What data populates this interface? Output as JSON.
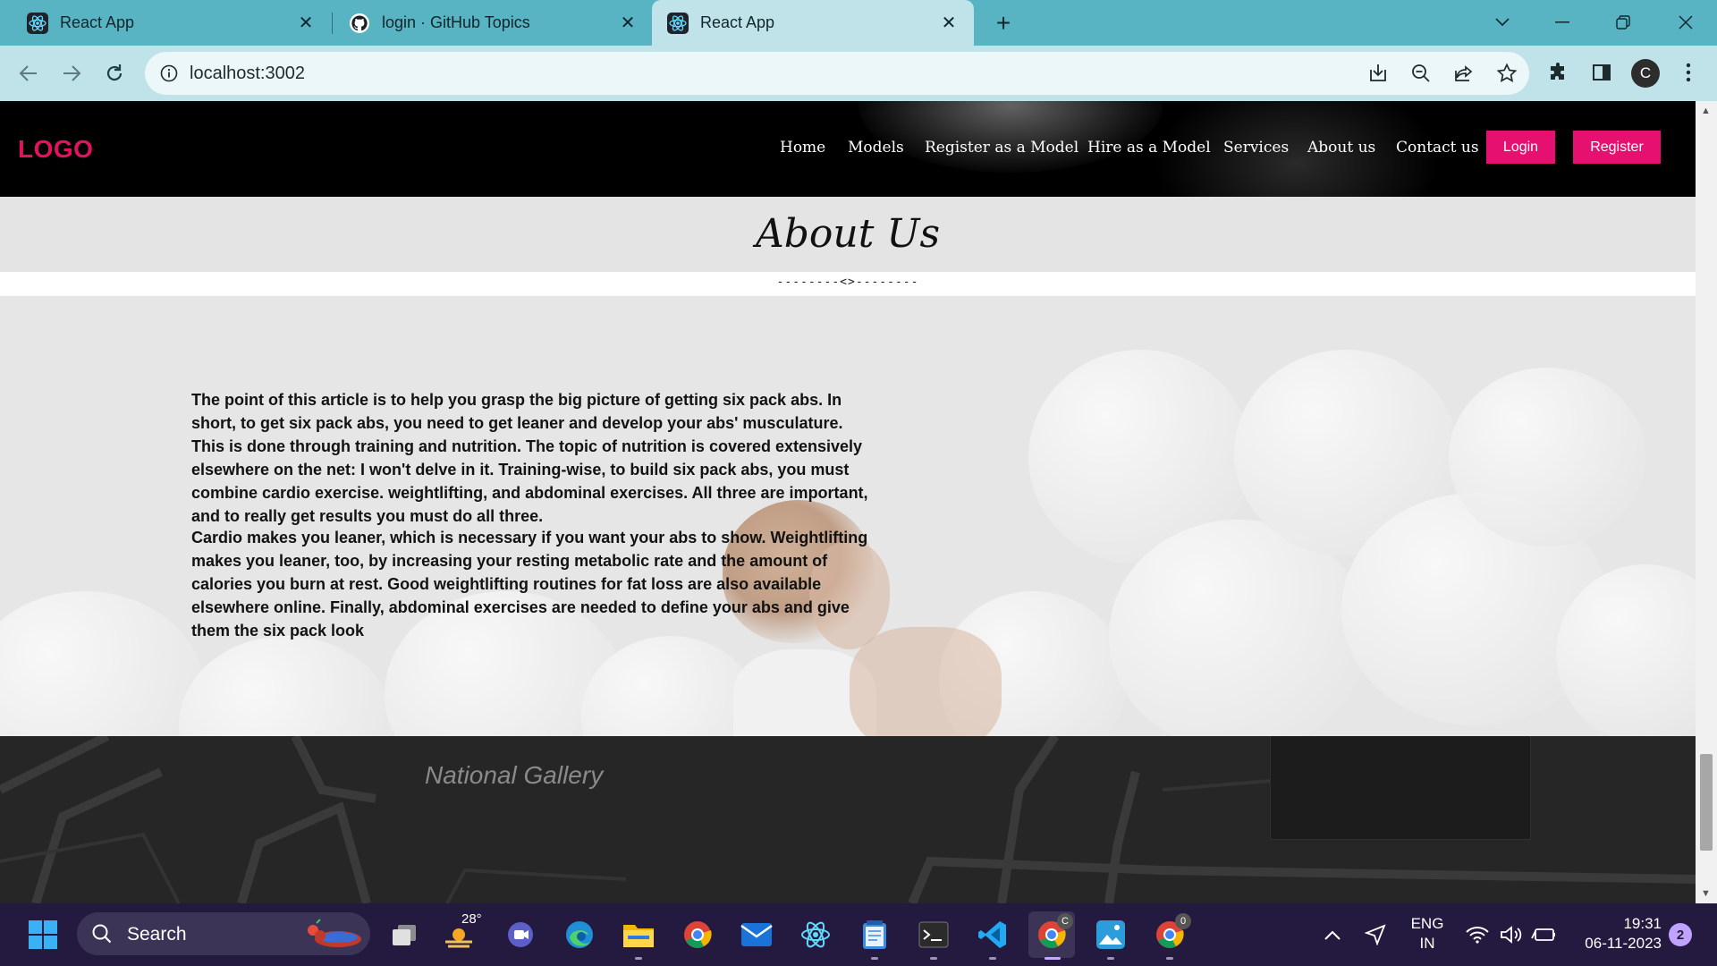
{
  "browser": {
    "tabs": [
      {
        "title": "React App",
        "icon": "react-icon",
        "active": false
      },
      {
        "title": "login · GitHub Topics",
        "icon": "github-icon",
        "active": false
      },
      {
        "title": "React App",
        "icon": "react-icon",
        "active": true
      }
    ],
    "url": "localhost:3002",
    "profile_initial": "C"
  },
  "site": {
    "logo": "LOGO",
    "nav": [
      "Home",
      "Models",
      "Register as a Model",
      "Hire as a Model",
      "Services",
      "About us",
      "Contact us"
    ],
    "login_label": "Login",
    "register_label": "Register",
    "about_title": "About Us",
    "divider": "--------<>--------",
    "paragraphs": [
      "The point of this article is to help you grasp the big picture of getting six pack abs. In short, to get six pack abs, you need to get leaner and develop your abs' musculature. This is done through training and nutrition. The topic of nutrition is covered extensively elsewhere on the net: I won't delve in it. Training-wise, to build six pack abs, you must combine cardio exercise. weightlifting, and abdominal exercises. All three are important, and to really get results you must do all three.",
      "Cardio makes you leaner, which is necessary if you want your abs to show. Weightlifting makes you leaner, too, by increasing your resting metabolic rate and the amount of calories you burn at rest. Good weightlifting routines for fat loss are also available elsewhere online. Finally, abdominal exercises are needed to define your abs and give them the six pack look"
    ],
    "map_label": "National Gallery",
    "colors": {
      "accent": "#e5106f",
      "logo": "#e2125e"
    }
  },
  "taskbar": {
    "search_label": "Search",
    "weather_temp": "28°",
    "chrome_badge_1": "C",
    "chrome_badge_2": "0",
    "lang_line1": "ENG",
    "lang_line2": "IN",
    "time": "19:31",
    "date": "06-11-2023",
    "notification_count": "2"
  }
}
